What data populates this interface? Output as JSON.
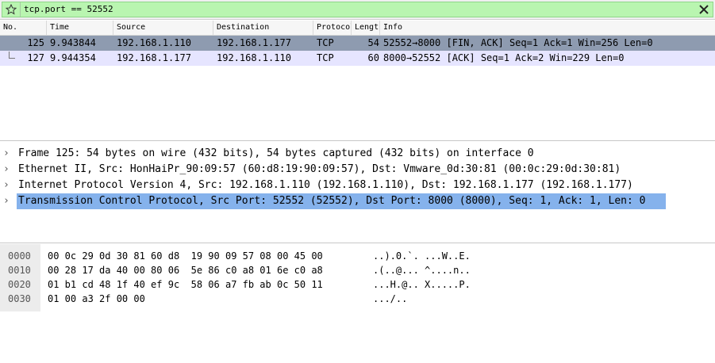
{
  "filter": {
    "value": "tcp.port == 52552",
    "bookmark_icon": "star-icon",
    "clear_icon": "close-icon",
    "background": "#b9f5b0"
  },
  "packet_list": {
    "columns": [
      "No.",
      "Time",
      "Source",
      "Destination",
      "Protocol",
      "Length",
      "Info"
    ],
    "rows": [
      {
        "no": "125",
        "time": "9.943844",
        "source": "192.168.1.110",
        "destination": "192.168.1.177",
        "protocol": "TCP",
        "length": "54",
        "info": "52552→8000 [FIN, ACK] Seq=1 Ack=1 Win=256 Len=0",
        "state": "selected"
      },
      {
        "no": "127",
        "time": "9.944354",
        "source": "192.168.1.177",
        "destination": "192.168.1.110",
        "protocol": "TCP",
        "length": "60",
        "info": "8000→52552 [ACK] Seq=1 Ack=2 Win=229 Len=0",
        "state": "related"
      }
    ],
    "colors": {
      "selected": "#8e9bb0",
      "related": "#e6e5ff"
    }
  },
  "details": [
    {
      "text": "Frame 125: 54 bytes on wire (432 bits), 54 bytes captured (432 bits) on interface 0"
    },
    {
      "text": "Ethernet II, Src: HonHaiPr_90:09:57 (60:d8:19:90:09:57), Dst: Vmware_0d:30:81 (00:0c:29:0d:30:81)"
    },
    {
      "text": "Internet Protocol Version 4, Src: 192.168.1.110 (192.168.1.110), Dst: 192.168.1.177 (192.168.1.177)"
    },
    {
      "text": "Transmission Control Protocol, Src Port: 52552 (52552), Dst Port: 8000 (8000), Seq: 1, Ack: 1, Len: 0",
      "selected": true
    }
  ],
  "hex": [
    {
      "offset": "0000",
      "bytes": "00 0c 29 0d 30 81 60 d8  19 90 09 57 08 00 45 00",
      "ascii": "..).0.`. ...W..E."
    },
    {
      "offset": "0010",
      "bytes": "00 28 17 da 40 00 80 06  5e 86 c0 a8 01 6e c0 a8",
      "ascii": ".(..@... ^....n.."
    },
    {
      "offset": "0020",
      "bytes": "01 b1 cd 48 1f 40 ef 9c  58 06 a7 fb ab 0c 50 11",
      "ascii": "...H.@.. X.....P."
    },
    {
      "offset": "0030",
      "bytes": "01 00 a3 2f 00 00",
      "ascii": ".../.."
    }
  ]
}
